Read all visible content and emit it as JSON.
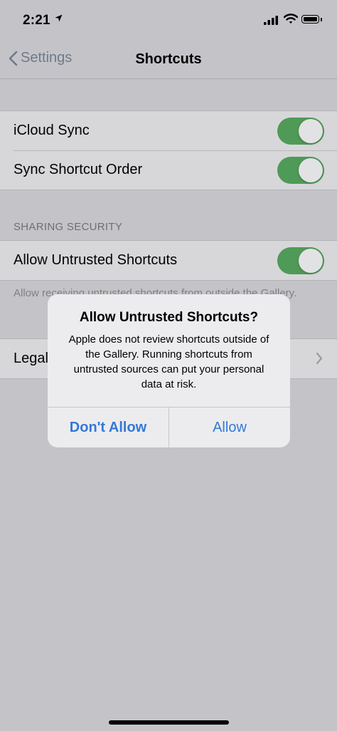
{
  "status_bar": {
    "time": "2:21",
    "location_icon": "location-arrow-icon"
  },
  "nav": {
    "back_label": "Settings",
    "title": "Shortcuts"
  },
  "sync_group": {
    "items": [
      {
        "label": "iCloud Sync",
        "toggle_on": true
      },
      {
        "label": "Sync Shortcut Order",
        "toggle_on": true
      }
    ]
  },
  "sharing_security": {
    "header": "SHARING SECURITY",
    "item": {
      "label": "Allow Untrusted Shortcuts",
      "toggle_on": true
    },
    "footer": "Allow receiving untrusted shortcuts from outside the Gallery."
  },
  "legal": {
    "label": "Legal"
  },
  "alert": {
    "title": "Allow Untrusted Shortcuts?",
    "message": "Apple does not review shortcuts outside of the Gallery. Running shortcuts from untrusted sources can put your personal data at risk.",
    "cancel_label": "Don't Allow",
    "confirm_label": "Allow"
  },
  "colors": {
    "toggle_on": "#4f9a57",
    "accent": "#3478d6",
    "dim_background": "#c4c4c8"
  }
}
